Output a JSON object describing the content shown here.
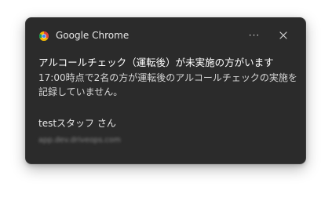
{
  "notification": {
    "app_name": "Google Chrome",
    "more_label": "···",
    "title": "アルコールチェック（運転後）が未実施の方がいます",
    "message": "17:00時点で2名の方が運転後のアルコールチェックの実施を記録していません。",
    "sender": "testスタッフ さん",
    "source": "app.dev.driveops.com",
    "icons": {
      "app": "chrome-icon",
      "more": "more-options-icon",
      "close": "close-icon"
    }
  },
  "colors": {
    "background": "#2b2b2b",
    "text_primary": "#ffffff",
    "text_secondary": "#d6d6d6",
    "text_muted": "#8a8a8a"
  }
}
